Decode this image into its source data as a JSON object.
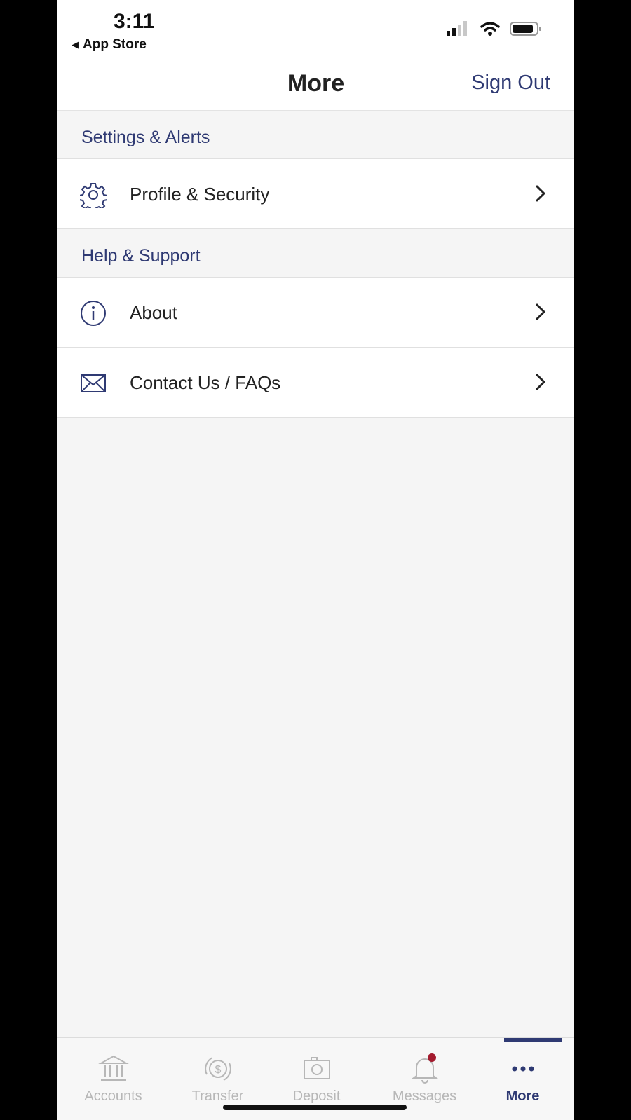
{
  "status": {
    "time": "3:11",
    "back_app": "App Store"
  },
  "nav": {
    "title": "More",
    "sign_out": "Sign Out"
  },
  "sections": [
    {
      "header": "Settings & Alerts",
      "items": [
        {
          "label": "Profile & Security",
          "icon": "gear-icon"
        }
      ]
    },
    {
      "header": "Help & Support",
      "items": [
        {
          "label": "About",
          "icon": "info-icon"
        },
        {
          "label": "Contact Us / FAQs",
          "icon": "envelope-icon"
        }
      ]
    }
  ],
  "tabs": [
    {
      "label": "Accounts",
      "icon": "bank-icon"
    },
    {
      "label": "Transfer",
      "icon": "dollar-transfer-icon"
    },
    {
      "label": "Deposit",
      "icon": "camera-icon"
    },
    {
      "label": "Messages",
      "icon": "bell-icon"
    },
    {
      "label": "More",
      "icon": "more-dots-icon",
      "active": true
    }
  ],
  "colors": {
    "accent": "#2f3a73",
    "badge": "#a31b2e",
    "inactive": "#b7b7b7"
  }
}
